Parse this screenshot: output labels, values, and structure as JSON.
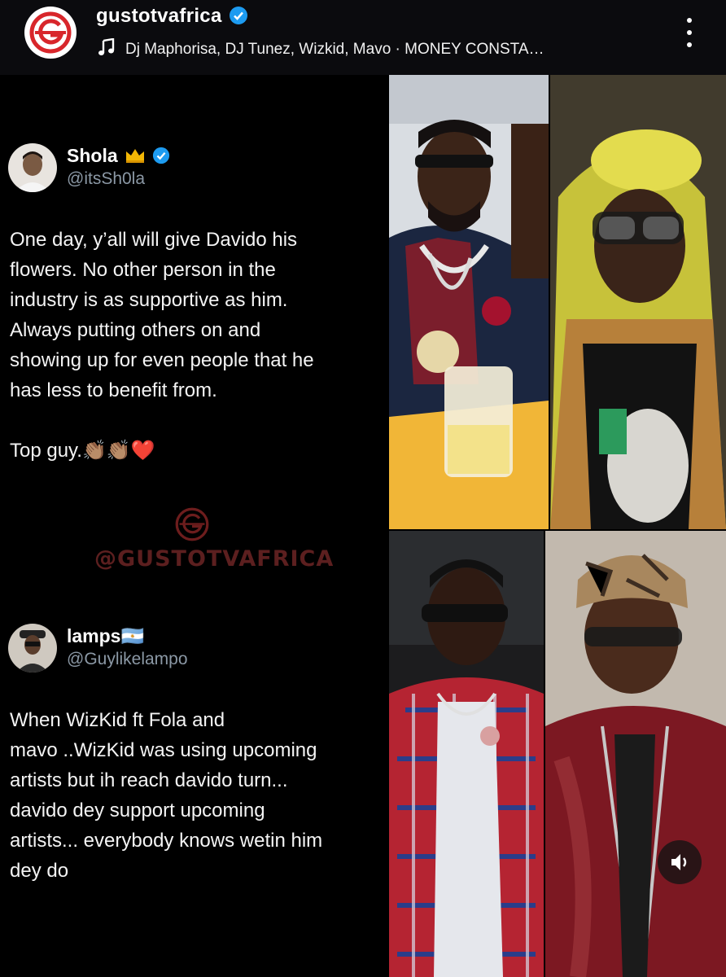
{
  "header": {
    "account_name": "gustotvafrica",
    "song_line": "Dj Maphorisa, DJ Tunez, Wizkid, Mavo · MONEY CONSTA…"
  },
  "tweet1": {
    "name": "Shola",
    "handle": "@itsSh0la",
    "lines": [
      "One day, y’all will give Davido his",
      "flowers. No other person in the",
      "industry is as supportive as him.",
      "Always putting others on and",
      "showing up for even people that he",
      "has less to benefit from."
    ],
    "closing": "Top guy.👏🏽👏🏽❤️"
  },
  "watermark": {
    "text": "@GUSTOTVAFRICA"
  },
  "tweet2": {
    "name": "lamps🇦🇷",
    "handle": "@Guylikelampo",
    "lines": [
      "When WizKid ft Fola and",
      "mavo ..WizKid was using upcoming",
      "artists but ih reach davido turn...",
      "davido dey support upcoming",
      "artists... everybody knows wetin him",
      "dey do"
    ]
  },
  "icons": {
    "logo": "gustotv-logo-icon",
    "verified": "verified-badge-icon",
    "music": "music-note-icon",
    "more": "more-options-icon",
    "mute": "volume-icon"
  },
  "colors": {
    "brand": "#d8262b",
    "verified": "#1d9bf0",
    "handle": "#8b98a5"
  }
}
